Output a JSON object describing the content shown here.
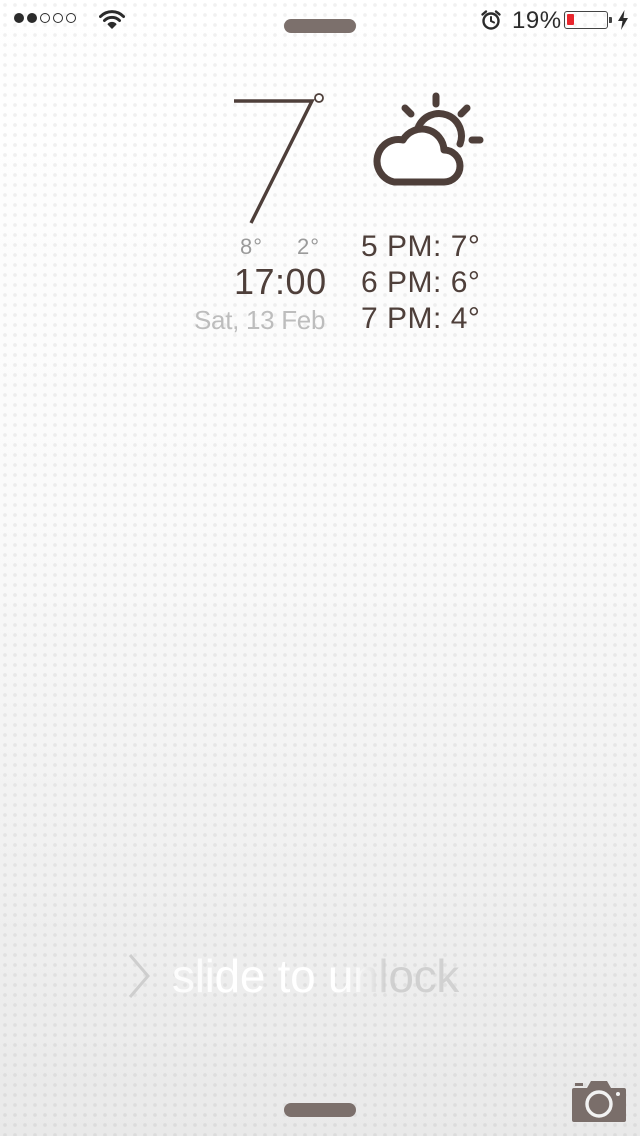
{
  "status_bar": {
    "signal_strength": 2,
    "signal_total": 5,
    "battery_percent": "19%",
    "battery_level": 0.19,
    "battery_color": "#e8262d",
    "icons": [
      "wifi-icon",
      "alarm-clock-icon",
      "battery-icon",
      "charging-bolt-icon"
    ]
  },
  "weather": {
    "current_temp": "7",
    "degree_symbol": "°",
    "high": "8°",
    "low": "2°",
    "time": "17:00",
    "date": "Sat, 13 Feb",
    "condition_icon": "partly-cloudy-icon",
    "forecast": [
      {
        "label": "5 PM: 7°"
      },
      {
        "label": "6 PM: 6°"
      },
      {
        "label": "7 PM: 4°"
      }
    ]
  },
  "lock_screen": {
    "unlock_text": "slide to unlock",
    "camera_icon": "camera-icon"
  },
  "colors": {
    "text_primary": "#4e3f3a",
    "text_muted": "#9a9a9a",
    "grabber": "#7c706c"
  }
}
